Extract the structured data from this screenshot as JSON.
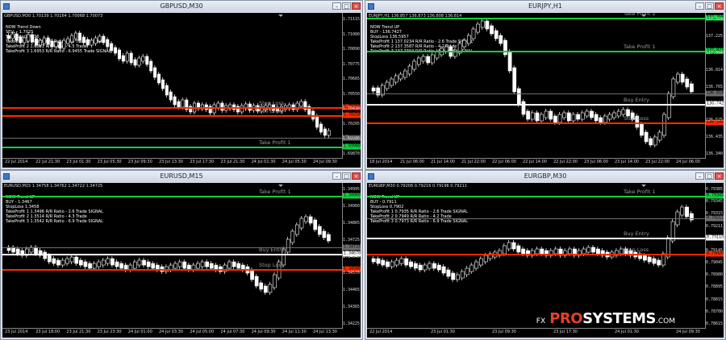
{
  "colors": {
    "red_line": "#ff2a00",
    "green_line": "#10d040",
    "white_line": "#ffffff",
    "grey_line": "#6e6e6e",
    "background": "#000000"
  },
  "watermark": {
    "fx": "FX",
    "pro": "PRO",
    "systems": "SYSTEMS",
    "com": ".COM"
  },
  "windows": [
    {
      "id": "gbpusd",
      "title": "GBPUSD,M30",
      "ohlc": "GBPUSD,M30  1.70139 1.70164 1.70068 1.70073",
      "active": true,
      "info": [
        "NOW Trend   Down",
        "SELL - 1.7025",
        "StopLoss 1.7036",
        "TakeProfit 1 1.6998 R/R Ratio - 2.5  Trade SIGNAL",
        "TakeProfit 2 1.6981 R/R Ratio - 4.5 Trade",
        "TakeProfit 3 1.6953 R/R Ratio - 6.9455 Trade SIGNAL"
      ],
      "yticks": [
        "1.71115",
        "1.71000",
        "1.70890",
        "1.70775",
        "1.70665",
        "1.70550",
        "1.70430",
        "1.70205",
        "1.69980",
        "1.69870"
      ],
      "xticks": [
        "22 Jul 2014",
        "22 Jul 21:30",
        "23 Jul 01:30",
        "23 Jul 05:30",
        "23 Jul 09:30",
        "23 Jul 13:30",
        "23 Jul 17:30",
        "23 Jul 21:30",
        "24 Jul 01:30",
        "24 Jul 05:30",
        "24 Jul 09:30"
      ],
      "levels": [
        {
          "label": "Stop Loss",
          "price": "1.70360",
          "color": "red"
        },
        {
          "label": "Sell Entry",
          "price": "1.70250",
          "color": "red"
        },
        {
          "label": "",
          "price": "1.70073",
          "color": "grey"
        },
        {
          "label": "Take Profit 1",
          "price": "1.69980",
          "color": "green"
        }
      ]
    },
    {
      "id": "eurjpy",
      "title": "EURJPY,H1",
      "ohlc": "EURJPY,H1  136.857 136.873 136.808 136.814",
      "active": false,
      "info": [
        "NOW Trend   UP",
        "BUY - 136.7427",
        "StopLoss 136.5957",
        "TakeProfit 1 137.0234 R/R Ratio - 2.6  Trade SIGNAL",
        "TakeProfit 2 137.3587 R/R Ratio - 4.2 Trade",
        "TakeProfit 3 137.7394 R/R Ratio - 6.9 Trade SIGNAL"
      ],
      "yticks": [
        "137.359",
        "137.225",
        "137.090",
        "136.814",
        "136.765",
        "136.615",
        "136.525",
        "136.435",
        "136.340"
      ],
      "xticks": [
        "18 Jul 2014",
        "21 Jul 06:00",
        "21 Jul 14:00",
        "21 Jul 22:00",
        "22 Jul 06:00",
        "22 Jul 14:00",
        "22 Jul 22:00",
        "23 Jul 06:00",
        "23 Jul 14:00",
        "23 Jul 22:00",
        "24 Jul 06:00"
      ],
      "levels": [
        {
          "label": "Take Profit 2",
          "price": "137.359",
          "color": "green"
        },
        {
          "label": "Take Profit 1",
          "price": "137.023",
          "color": "green"
        },
        {
          "label": "",
          "price": "136.814",
          "color": "grey"
        },
        {
          "label": "Buy Entry",
          "price": "136.742",
          "color": "white"
        },
        {
          "label": "Stop Loss",
          "price": "136.595",
          "color": "red"
        }
      ]
    },
    {
      "id": "eurusd",
      "title": "EURUSD,M15",
      "ohlc": "EURUSD,M15  1.34758 1.34762 1.34722 1.34725",
      "active": false,
      "info": [
        "NOW Trend   UP",
        "BUY - 1.3467",
        "StopLoss 1.3458",
        "TakeProfit 1 1.3496 R/R Ratio - 2.6  Trade SIGNAL",
        "TakeProfit 2 1.3514 R/R Ratio - 4.3 Trade",
        "TakeProfit 3 1.3542 R/R Ratio - 6.9 Trade SIGNAL"
      ],
      "yticks": [
        "1.34995",
        "1.34960",
        "1.34865",
        "1.34725",
        "1.34645",
        "1.34570",
        "1.34465",
        "1.34365",
        "1.34225"
      ],
      "xticks": [
        "23 Jul 2014",
        "23 Jul 18:00",
        "23 Jul 21:30",
        "23 Jul 23:30",
        "24 Jul 01:00",
        "24 Jul 03:30",
        "24 Jul 05:00",
        "24 Jul 07:30",
        "24 Jul 09:30",
        "24 Jul 11:30",
        "24 Jul 13:30"
      ],
      "levels": [
        {
          "label": "Take Profit 1",
          "price": "1.34960",
          "color": "green"
        },
        {
          "label": "",
          "price": "1.34725",
          "color": "grey"
        },
        {
          "label": "Buy Entry",
          "price": "1.34670",
          "color": "white"
        },
        {
          "label": "Stop Loss",
          "price": "1.34580",
          "color": "red"
        }
      ]
    },
    {
      "id": "eurgbp",
      "title": "EURGBP,M30",
      "ohlc": "EURGBP,M30  0.79206 0.79216 0.79196 0.79211",
      "active": false,
      "info": [
        "NOW Trend   UP",
        "BUY - 0.7911",
        "StopLoss 0.7902",
        "TakeProfit 1 0.7935 R/R Ratio - 2.6  Trade SIGNAL",
        "TakeProfit 2 0.7949 R/R Ratio - 4.2 Trade",
        "TakeProfit 3 0.7973 R/R Ratio - 6.9 Trade SIGNAL"
      ],
      "yticks": [
        "0.79385",
        "0.79345",
        "0.79315",
        "0.79211",
        "0.79175",
        "0.79145",
        "0.79045",
        "0.78980",
        "0.78895",
        "0.78815",
        "0.78700",
        "0.78615"
      ],
      "xticks": [
        "22 Jul 2014",
        "23 Jul 01:30",
        "23 Jul 09:30",
        "23 Jul 17:30",
        "24 Jul 01:30",
        "24 Jul 09:30"
      ],
      "levels": [
        {
          "label": "Take Profit 1",
          "price": "0.79345",
          "color": "green"
        },
        {
          "label": "",
          "price": "0.79211",
          "color": "grey"
        },
        {
          "label": "Buy Entry",
          "price": "0.79110",
          "color": "white"
        },
        {
          "label": "Stop Loss",
          "price": "0.79020",
          "color": "red"
        }
      ]
    }
  ]
}
